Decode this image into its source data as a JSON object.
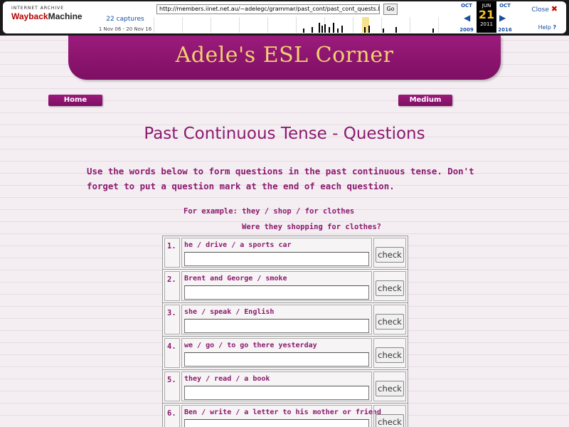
{
  "wayback": {
    "logo_top": "INTERNET ARCHIVE",
    "logo_main_a": "Wayback",
    "logo_main_b": "Machine",
    "url": "http://members.iinet.net.au/~adelegc/grammar/past_cont/past_cont_quests.html",
    "go_label": "Go",
    "captures": "22 captures",
    "range": "1 Nov 06 - 20 Nov 16",
    "prev_month": "OCT",
    "prev_year": "2009",
    "cur_month": "JUN",
    "cur_day": "21",
    "cur_year": "2011",
    "next_month": "OCT",
    "next_year": "2016",
    "close_label": "Close",
    "help_label": "Help"
  },
  "banner": {
    "title": "Adele's ESL Corner"
  },
  "nav": {
    "home": "Home",
    "medium": "Medium"
  },
  "page": {
    "title": "Past Continuous Tense - Questions",
    "instructions": "Use the words below to form questions in the past continuous tense. Don't forget to put a question mark at the end of each question.",
    "example_prompt": "For example: they / shop / for clothes",
    "example_answer": "Were they shopping for clothes?"
  },
  "exercise": {
    "check_label": "check",
    "items": [
      {
        "num": "1.",
        "prompt": "he / drive / a sports car",
        "value": ""
      },
      {
        "num": "2.",
        "prompt": "Brent and George / smoke",
        "value": ""
      },
      {
        "num": "3.",
        "prompt": "she / speak / English",
        "value": ""
      },
      {
        "num": "4.",
        "prompt": "we / go / to go there yesterday",
        "value": ""
      },
      {
        "num": "5.",
        "prompt": "they / read / a book",
        "value": ""
      },
      {
        "num": "6.",
        "prompt": "Ben / write / a letter to his mother or friend",
        "value": ""
      }
    ]
  },
  "colors": {
    "accent": "#8b1a6e",
    "banner": "#9b1b7c",
    "banner_text": "#f2d070"
  }
}
